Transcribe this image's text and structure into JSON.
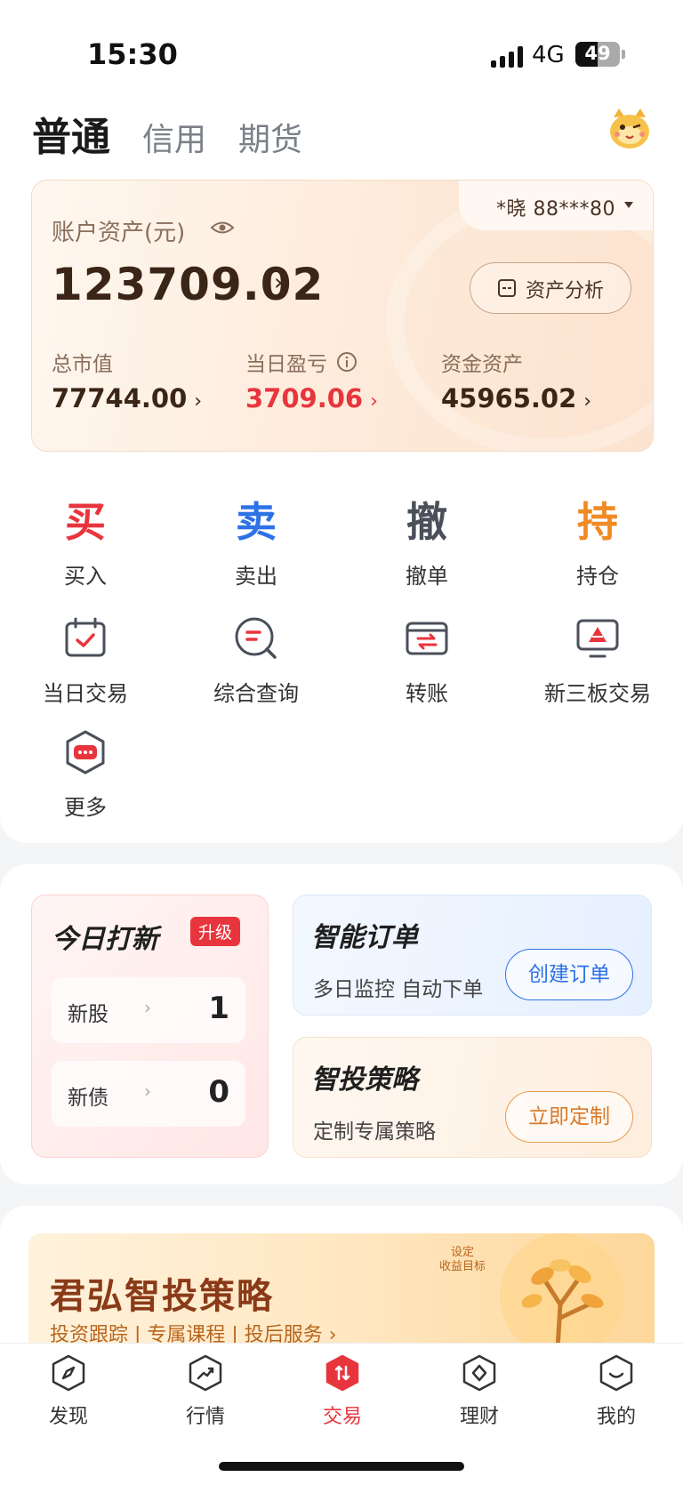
{
  "status_bar": {
    "time": "15:30",
    "network": "4G",
    "battery": "49"
  },
  "account_tabs": [
    {
      "label": "普通",
      "active": true
    },
    {
      "label": "信用",
      "active": false
    },
    {
      "label": "期货",
      "active": false
    }
  ],
  "asset_card": {
    "account_name": "*晓 88***80",
    "label": "账户资产(元)",
    "total": "123709.02",
    "analysis_button": "资产分析",
    "metrics": [
      {
        "label": "总市值",
        "value": "77744.00"
      },
      {
        "label": "当日盈亏",
        "value": "3709.06"
      },
      {
        "label": "资金资产",
        "value": "45965.02"
      }
    ]
  },
  "quick_actions": [
    {
      "glyph": "买",
      "label": "买入",
      "color": "#e8353d"
    },
    {
      "glyph": "卖",
      "label": "卖出",
      "color": "#2d72e6"
    },
    {
      "glyph": "撤",
      "label": "撤单",
      "color": "#4a4f5a"
    },
    {
      "glyph": "持",
      "label": "持仓",
      "color": "#f08a24"
    }
  ],
  "functions": [
    {
      "label": "当日交易",
      "icon": "calendar-check-icon"
    },
    {
      "label": "综合查询",
      "icon": "query-icon"
    },
    {
      "label": "转账",
      "icon": "transfer-icon"
    },
    {
      "label": "新三板交易",
      "icon": "neeq-icon"
    },
    {
      "label": "更多",
      "icon": "more-icon"
    }
  ],
  "ipo": {
    "title": "今日打新",
    "badge": "升级",
    "rows": [
      {
        "label": "新股",
        "value": "1"
      },
      {
        "label": "新债",
        "value": "0"
      }
    ]
  },
  "smart_order": {
    "title": "智能订单",
    "desc": "多日监控 自动下单",
    "button": "创建订单"
  },
  "smart_invest": {
    "title": "智投策略",
    "desc": "定制专属策略",
    "button": "立即定制"
  },
  "banner": {
    "title": "君弘智投策略",
    "subtitle": "投资跟踪 | 专属课程 | 投后服务 ›",
    "note": "设定\n收益目标"
  },
  "tab_bar": [
    {
      "label": "发现",
      "icon": "compass-icon",
      "active": false
    },
    {
      "label": "行情",
      "icon": "trend-icon",
      "active": false
    },
    {
      "label": "交易",
      "icon": "trade-icon",
      "active": true
    },
    {
      "label": "理财",
      "icon": "wealth-icon",
      "active": false
    },
    {
      "label": "我的",
      "icon": "profile-icon",
      "active": false
    }
  ],
  "colors": {
    "accent": "#e8353d",
    "blue": "#2d72e6",
    "gold_text": "#3a2516"
  }
}
